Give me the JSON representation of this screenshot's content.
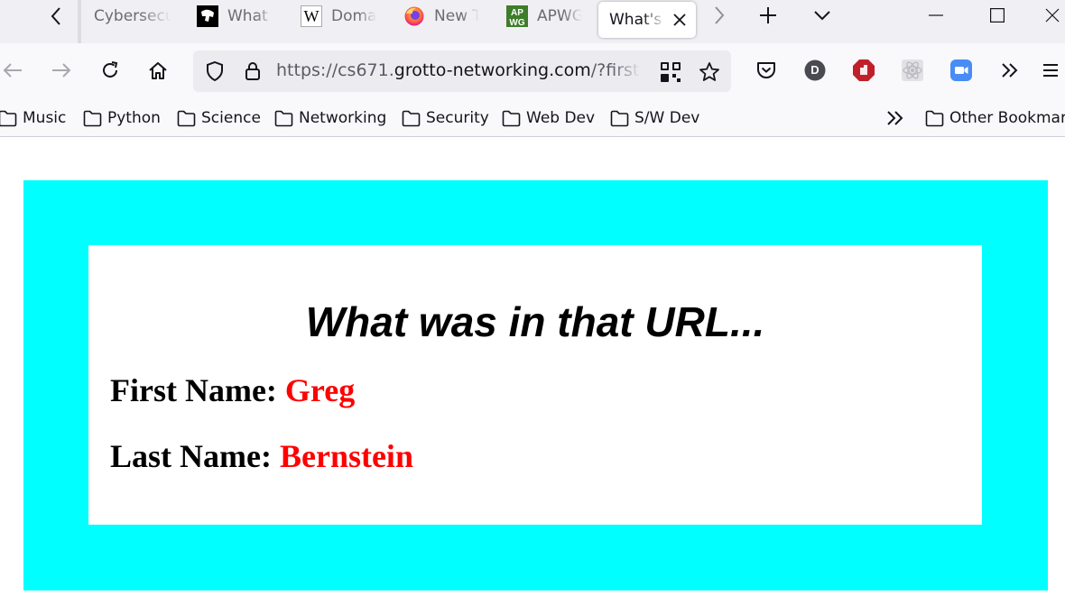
{
  "browser": {
    "tabs": [
      {
        "label": "Cybersecu",
        "icon": "none"
      },
      {
        "label": "What i",
        "icon": "hacker-icon"
      },
      {
        "label": "Doma",
        "icon": "wikipedia-icon"
      },
      {
        "label": "New T",
        "icon": "firefox-icon"
      },
      {
        "label": "APWG",
        "icon": "apwg-icon"
      },
      {
        "label": "What's in",
        "icon": "none"
      }
    ],
    "apwg_logo_text": "APWG",
    "url": {
      "prefix": "https://cs671.",
      "host": "grotto-networking.com",
      "suffix": "/?first=Greg"
    },
    "account_initial": "D",
    "bookmarks": [
      "Music",
      "Python",
      "Science",
      "Networking",
      "Security",
      "Web Dev",
      "S/W Dev"
    ],
    "other_bookmarks": "Other Bookmarks"
  },
  "page": {
    "heading": "What was in that URL...",
    "first_label": "First Name:",
    "first_value": "Greg",
    "last_label": "Last Name:",
    "last_value": "Bernstein",
    "colors": {
      "outer_background": "#00ffff",
      "value_text": "#ff0000"
    }
  }
}
